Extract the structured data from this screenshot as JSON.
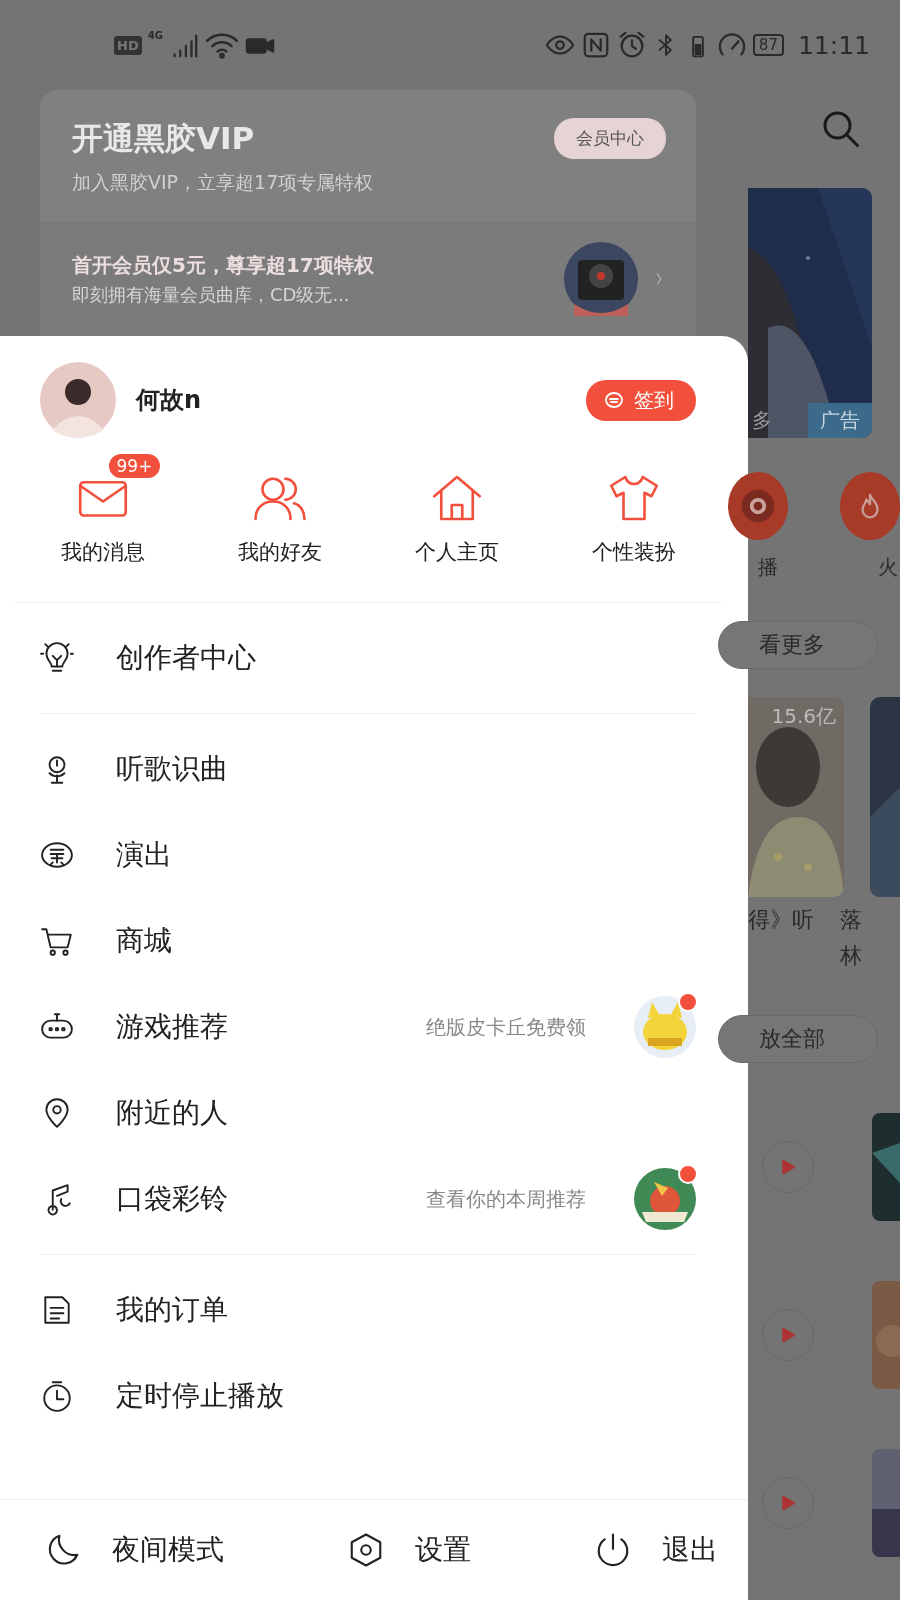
{
  "status_bar": {
    "badges": [
      "HD",
      "4G"
    ],
    "battery": "87",
    "time": "11:11"
  },
  "vip_card": {
    "title": "开通黑胶VIP",
    "subtitle": "加入黑胶VIP，立享超17项专属特权",
    "button": "会员中心",
    "promo_title": "首开会员仅5元，尊享超17项特权",
    "promo_text": "即刻拥有海量会员曲库，CD级无..."
  },
  "background": {
    "banner_text": "多",
    "banner_tag": "广告",
    "shortcuts": [
      "播",
      "火"
    ],
    "more_pill": "看更多",
    "play_count": "15.6亿",
    "card_title": "得》听",
    "side_titles": [
      "落",
      "林"
    ],
    "play_all_pill": "放全部"
  },
  "drawer": {
    "user": {
      "name": "何故n",
      "checkin": "签到"
    },
    "quick": [
      {
        "label": "我的消息",
        "badge": "99+"
      },
      {
        "label": "我的好友"
      },
      {
        "label": "个人主页"
      },
      {
        "label": "个性装扮"
      }
    ],
    "sections": [
      [
        {
          "kind": "plain",
          "label": "创作者中心"
        }
      ],
      [
        {
          "kind": "plain",
          "label": "听歌识曲"
        },
        {
          "kind": "plain",
          "label": "演出"
        },
        {
          "kind": "plain",
          "label": "商城"
        },
        {
          "kind": "promo",
          "label": "游戏推荐",
          "hint": "绝版皮卡丘免费领"
        },
        {
          "kind": "plain",
          "label": "附近的人"
        },
        {
          "kind": "promo",
          "label": "口袋彩铃",
          "hint": "查看你的本周推荐"
        }
      ],
      [
        {
          "kind": "plain",
          "label": "我的订单"
        },
        {
          "kind": "plain",
          "label": "定时停止播放"
        }
      ]
    ],
    "bottom": [
      {
        "label": "夜间模式"
      },
      {
        "label": "设置"
      },
      {
        "label": "退出"
      }
    ]
  }
}
